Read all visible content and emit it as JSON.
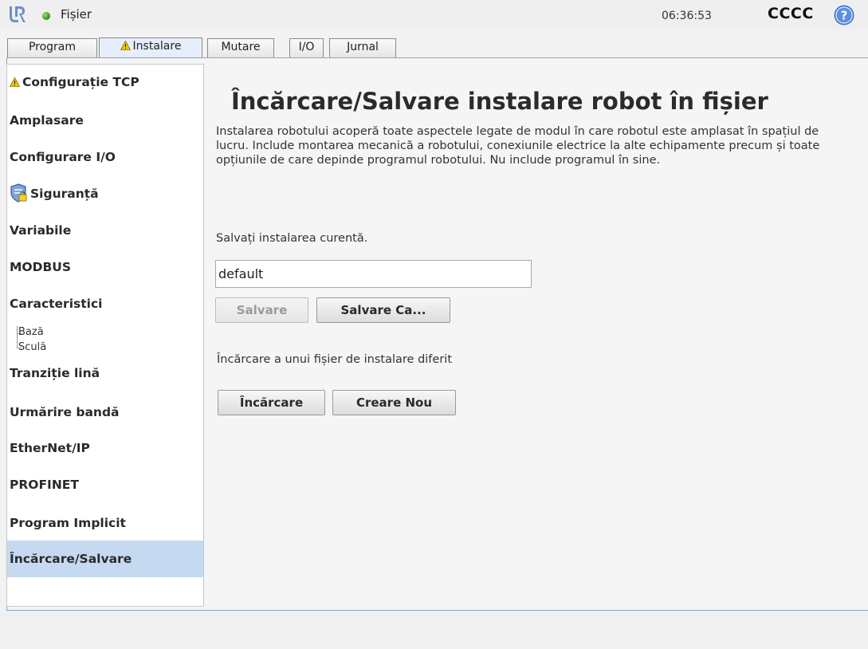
{
  "header": {
    "app_title": "Fișier",
    "clock": "06:36:53",
    "robot_name": "CCCC",
    "help_label": "?",
    "status_color": "#3a9a1e"
  },
  "tabs": [
    {
      "label": "Program",
      "active": false,
      "icon": ""
    },
    {
      "label": "Instalare",
      "active": true,
      "icon": "warning-icon"
    },
    {
      "label": "Mutare",
      "active": false,
      "icon": ""
    },
    {
      "label": "I/O",
      "active": false,
      "icon": ""
    },
    {
      "label": "Jurnal",
      "active": false,
      "icon": ""
    }
  ],
  "sidebar": {
    "items": [
      {
        "label": "Configurație TCP",
        "icon": "warning-icon"
      },
      {
        "label": "Amplasare"
      },
      {
        "label": "Configurare I/O"
      },
      {
        "label": "Siguranță",
        "icon": "safety-shield-icon"
      },
      {
        "label": "Variabile"
      },
      {
        "label": "MODBUS"
      },
      {
        "label": "Caracteristici",
        "children": [
          "Bază",
          "Sculă"
        ]
      },
      {
        "label": "Tranziție lină"
      },
      {
        "label": "Urmărire bandă"
      },
      {
        "label": "EtherNet/IP"
      },
      {
        "label": "PROFINET"
      },
      {
        "label": "Program Implicit"
      },
      {
        "label": "Încărcare/Salvare",
        "selected": true
      }
    ]
  },
  "main": {
    "title": "Încărcare/Salvare instalare robot în fișier",
    "description": "Instalarea robotului acoperă toate aspectele legate de modul în care robotul este amplasat în spațiul de lucru. Include montarea mecanică a robotului, conexiunile electrice la alte echipamente precum și toate opțiunile de care depinde programul robotului. Nu include programul în sine.",
    "save_label": "Salvați instalarea curentă.",
    "filename_value": "default",
    "save_button": "Salvare",
    "save_as_button": "Salvare Ca...",
    "load_label": "Încărcare a unui fișier de instalare diferit",
    "load_button": "Încărcare",
    "new_button": "Creare Nou"
  },
  "colors": {
    "selected_bg": "#c5daf1",
    "warning": "#f5c400",
    "help": "#4a7fd4"
  }
}
